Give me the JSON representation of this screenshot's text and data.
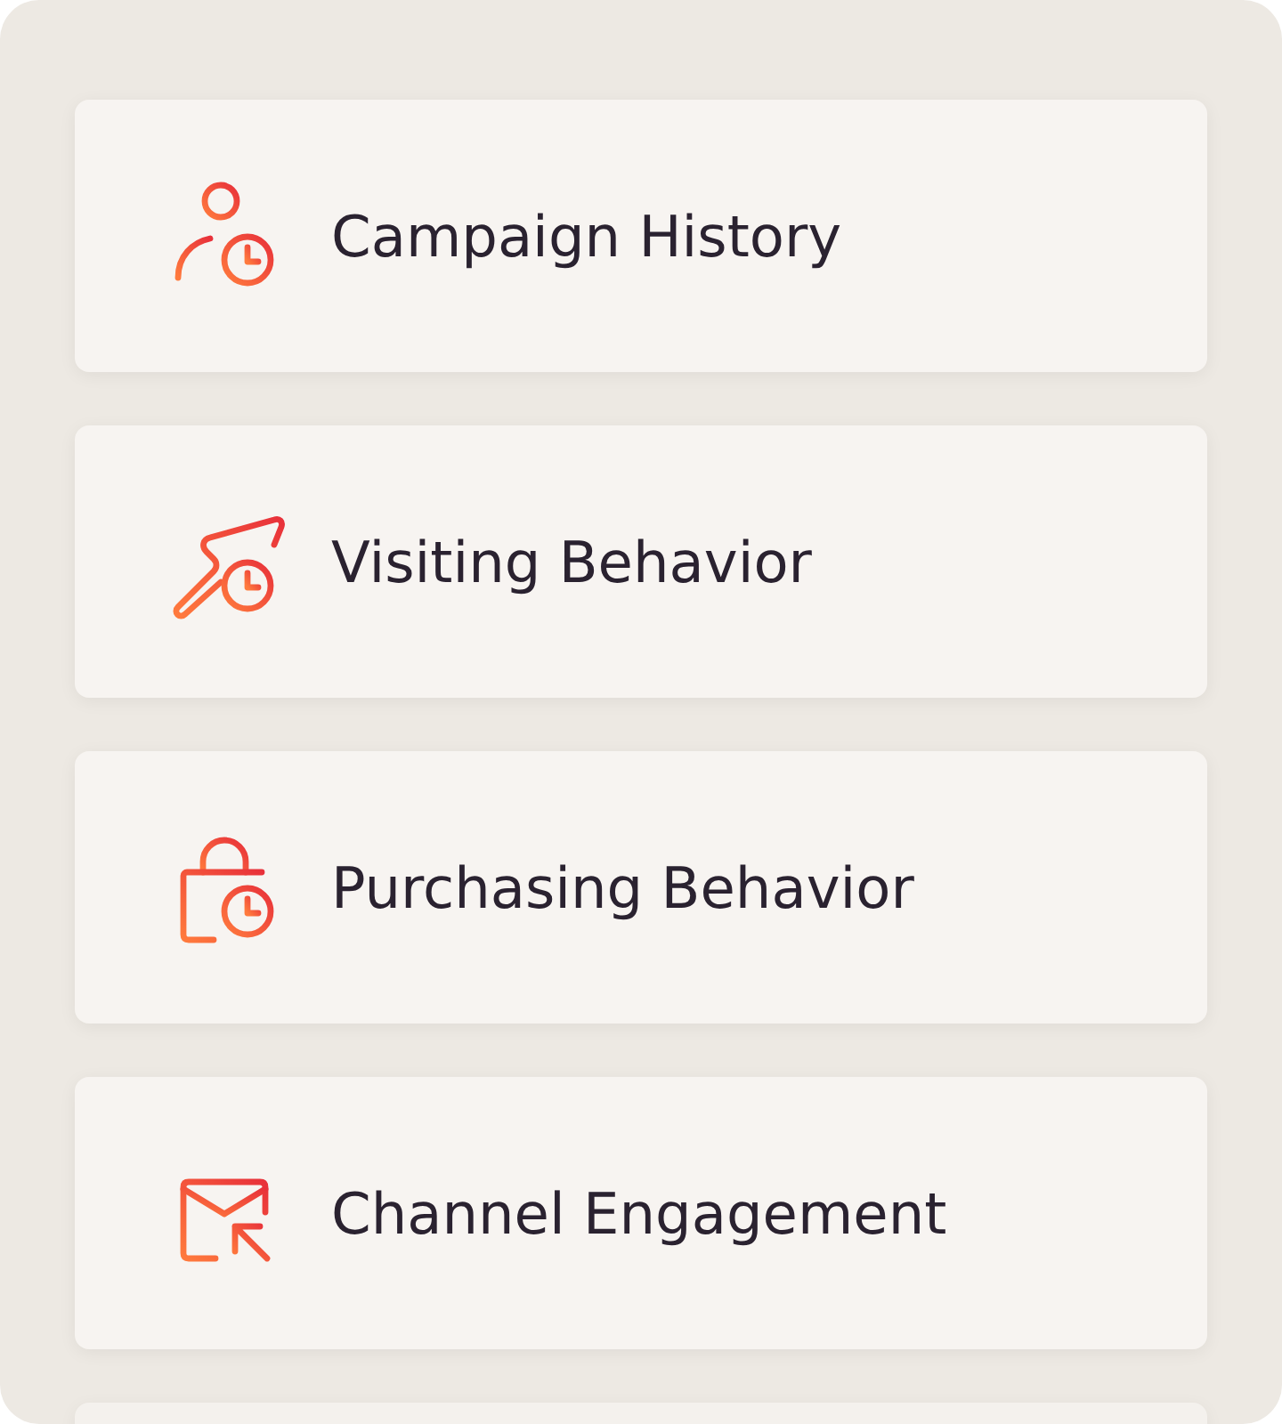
{
  "items": [
    {
      "label": "Campaign History",
      "kind": "person-clock"
    },
    {
      "label": "Visiting Behavior",
      "kind": "cursor-clock"
    },
    {
      "label": "Purchasing Behavior",
      "kind": "bag-clock"
    },
    {
      "label": "Channel Engagement",
      "kind": "mail-arrow"
    }
  ]
}
